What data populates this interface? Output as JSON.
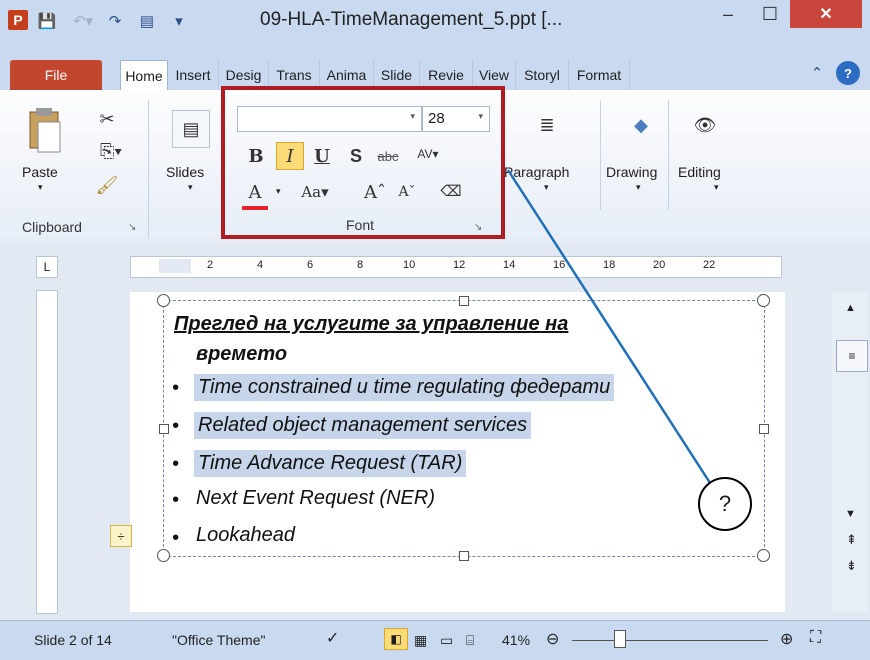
{
  "window": {
    "title": "09-HLA-TimeManagement_5.ppt [...",
    "app_icon": "P",
    "controls": {
      "minimize": "–",
      "maximize": "☐",
      "close": "✕"
    }
  },
  "quick_access": [
    "save-icon",
    "undo-icon",
    "redo-icon",
    "view-icon",
    "customize-icon"
  ],
  "tabs": [
    "File",
    "Home",
    "Insert",
    "Design",
    "Transitions",
    "Animations",
    "Slide",
    "Review",
    "View",
    "Storyboard",
    "Format"
  ],
  "tabs_visible": [
    "File",
    "Home",
    "Insert",
    "Desig",
    "Trans",
    "Anima",
    "Slide",
    "Revie",
    "View",
    "Storyl",
    "Format"
  ],
  "ribbon": {
    "clipboard": {
      "paste_label": "Paste",
      "group_label": "Clipboard"
    },
    "slides": {
      "label": "Slides"
    },
    "font": {
      "group_label": "Font",
      "font_name": "",
      "font_size": "28"
    },
    "paragraph": {
      "label": "Paragraph"
    },
    "drawing": {
      "label": "Drawing"
    },
    "editing": {
      "label": "Editing"
    }
  },
  "ruler": {
    "ticks": [
      "2",
      "4",
      "6",
      "8",
      "10",
      "12",
      "14",
      "16",
      "18",
      "20",
      "22"
    ]
  },
  "slide": {
    "title_line1": "Преглед на услугите за управление  на",
    "title_line2": "времето",
    "bullets": [
      "Time constrained и time regulating  федерати",
      "Related  object management  services",
      "Time Advance Request (TAR)",
      "Next Event Request (NER)",
      "Lookahead"
    ],
    "bullet_char": "•"
  },
  "callout": {
    "text": "?"
  },
  "status": {
    "slide_info": "Slide 2 of 14",
    "theme": "\"Office Theme\"",
    "zoom": "41%"
  },
  "colors": {
    "highlight_border": "#b01c24",
    "callout_line": "#1f6fb8",
    "file_tab": "#c2452d"
  }
}
